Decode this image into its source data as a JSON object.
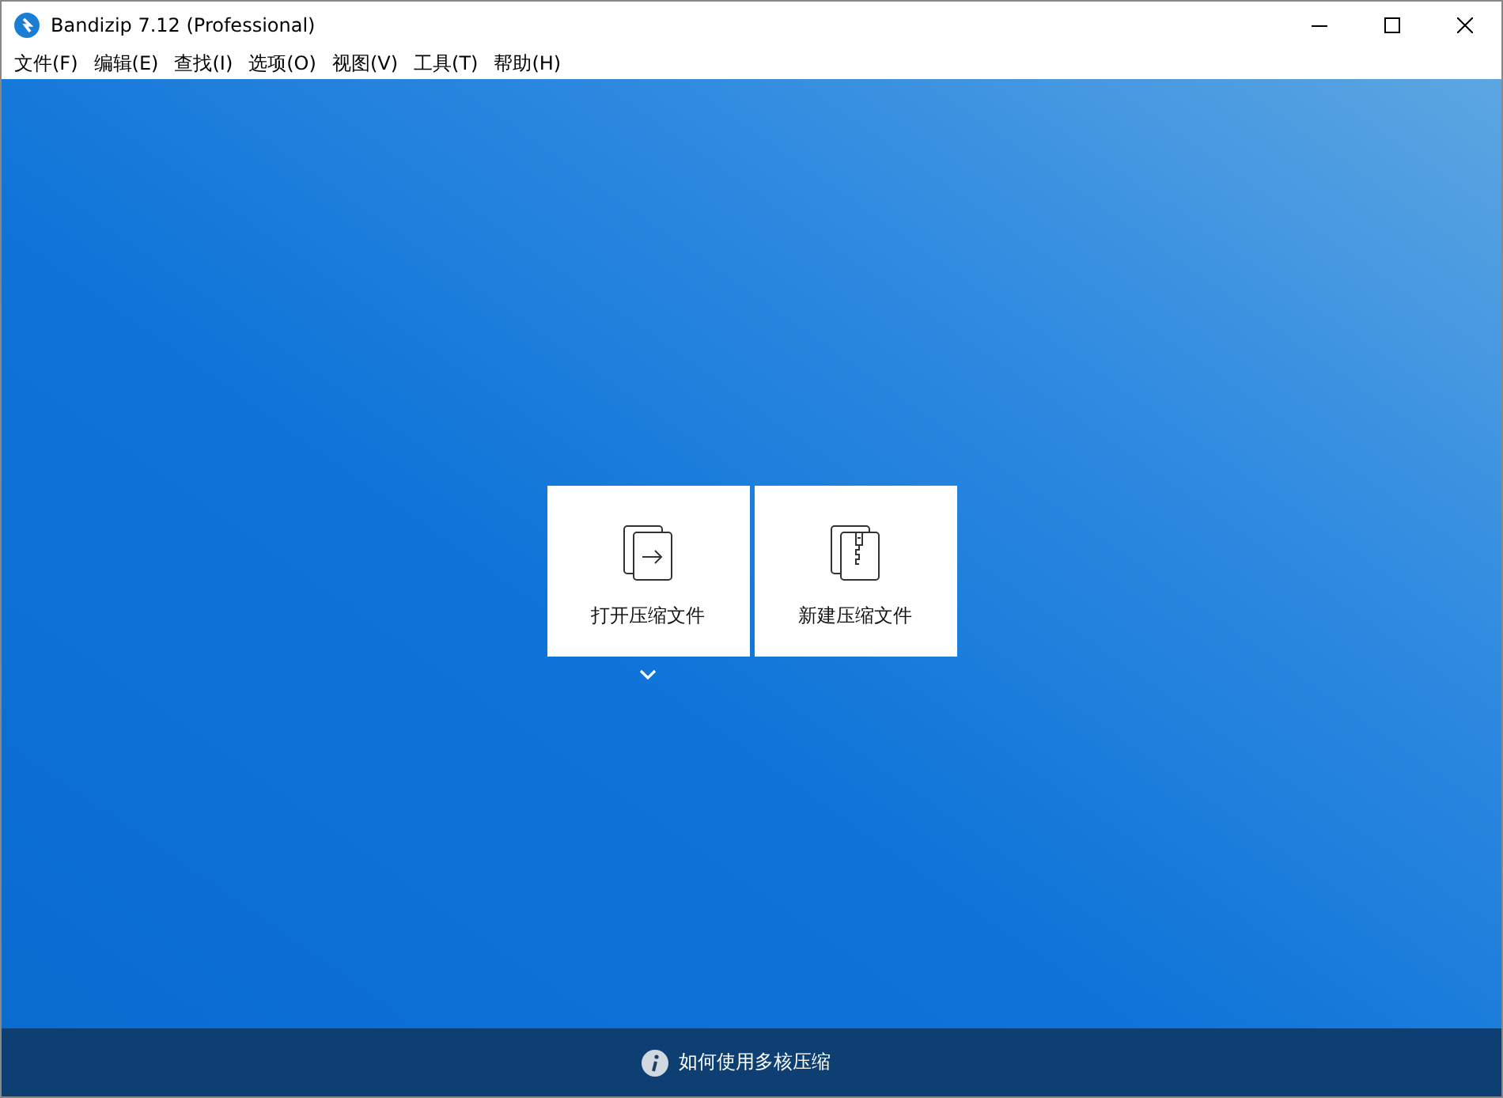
{
  "window": {
    "title": "Bandizip 7.12 (Professional)"
  },
  "menu": [
    "文件(F)",
    "编辑(E)",
    "查找(I)",
    "选项(O)",
    "视图(V)",
    "工具(T)",
    "帮助(H)"
  ],
  "actions": [
    {
      "kind": "open",
      "label": "打开压缩文件"
    },
    {
      "kind": "new",
      "label": "新建压缩文件"
    }
  ],
  "status_bar": {
    "tip": "如何使用多核压缩"
  }
}
